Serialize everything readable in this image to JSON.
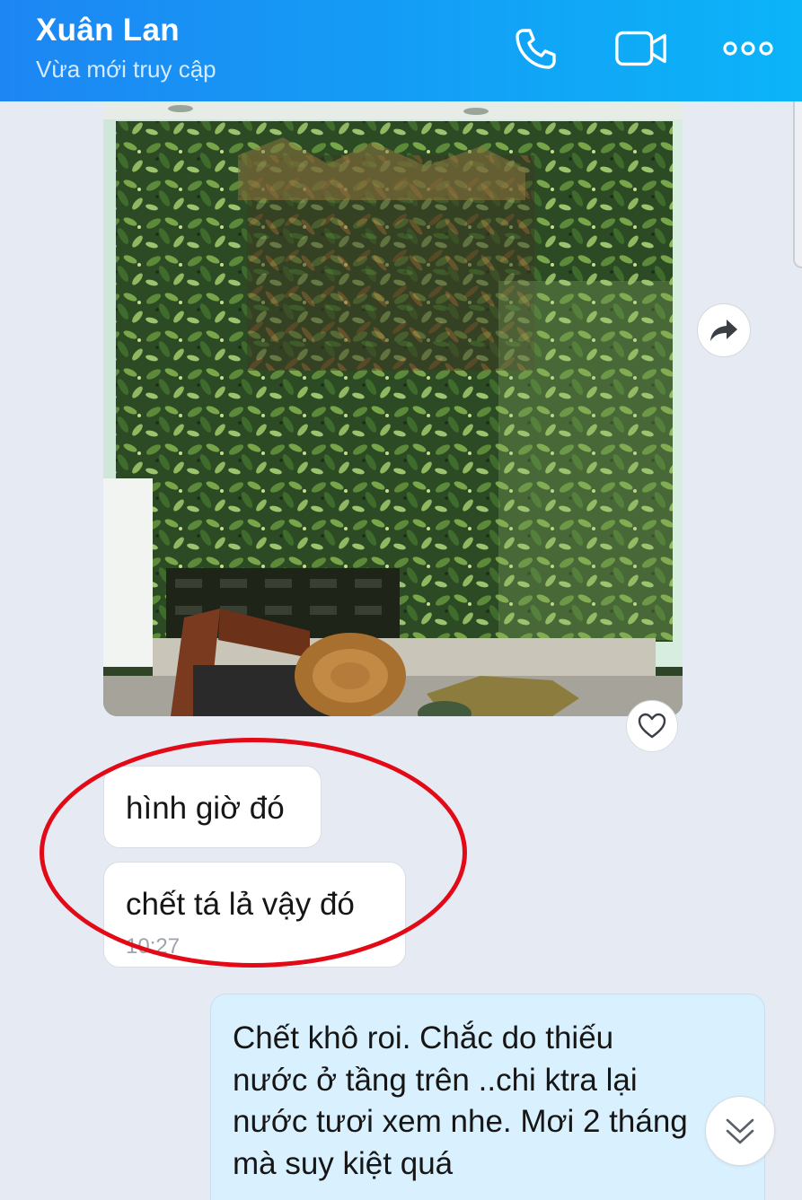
{
  "header": {
    "contact_name": "Xuân Lan",
    "status": "Vừa mới truy cập",
    "call_icon": "phone-icon",
    "video_icon": "video-camera-icon",
    "more_icon": "more-dots-icon",
    "gradient_start": "#1d86f3",
    "gradient_end": "#0cb4f8"
  },
  "messages": [
    {
      "type": "image",
      "direction": "incoming",
      "alt": "vertical garden wall photo"
    },
    {
      "type": "text",
      "direction": "incoming",
      "text": "hình giờ đó"
    },
    {
      "type": "text",
      "direction": "incoming",
      "text": "chết tá lả vậy đó",
      "time": "10:27"
    },
    {
      "type": "text",
      "direction": "outgoing",
      "text": "Chết khô roi. Chắc do thiếu\nnước ở tầng trên ..chi ktra lại\nnước tươi xem nhe. Mơi 2 tháng\nmà suy kiệt quá"
    }
  ],
  "actions": {
    "share_icon": "share-arrow-icon",
    "react_icon": "heart-icon",
    "scroll_down_icon": "double-chevron-down-icon"
  },
  "colors": {
    "chat_background": "#e6eaf2",
    "incoming_bubble": "#ffffff",
    "outgoing_bubble": "#d9f1fe",
    "annotation_circle": "#e30a17"
  }
}
